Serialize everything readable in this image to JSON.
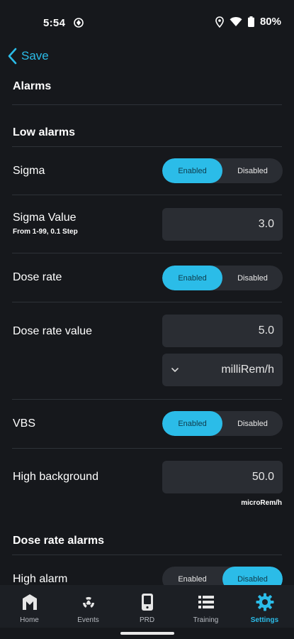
{
  "status_bar": {
    "time": "5:54",
    "battery": "80%"
  },
  "nav": {
    "back_label": "Save"
  },
  "page": {
    "title": "Alarms"
  },
  "sections": {
    "low_alarms": "Low alarms",
    "dose_rate_alarms": "Dose rate alarms"
  },
  "toggle_labels": {
    "enabled": "Enabled",
    "disabled": "Disabled"
  },
  "rows": {
    "sigma": {
      "label": "Sigma",
      "state": "enabled"
    },
    "sigma_value": {
      "label": "Sigma Value",
      "hint": "From 1-99, 0.1 Step",
      "value": "3.0"
    },
    "dose_rate": {
      "label": "Dose rate",
      "state": "enabled"
    },
    "dose_rate_value": {
      "label": "Dose rate value",
      "value": "5.0",
      "unit_selected": "milliRem/h"
    },
    "vbs": {
      "label": "VBS",
      "state": "enabled"
    },
    "high_background": {
      "label": "High background",
      "value": "50.0",
      "unit": "microRem/h"
    },
    "high_alarm": {
      "label": "High alarm",
      "state": "disabled"
    }
  },
  "tabs": [
    {
      "label": "Home",
      "icon": "home-m-logo-icon"
    },
    {
      "label": "Events",
      "icon": "radiation-icon"
    },
    {
      "label": "PRD",
      "icon": "device-icon"
    },
    {
      "label": "Training",
      "icon": "list-icon"
    },
    {
      "label": "Settings",
      "icon": "gear-icon",
      "active": true
    }
  ],
  "colors": {
    "accent": "#2bbce8",
    "background": "#16181c",
    "surface": "#2a2d33"
  }
}
